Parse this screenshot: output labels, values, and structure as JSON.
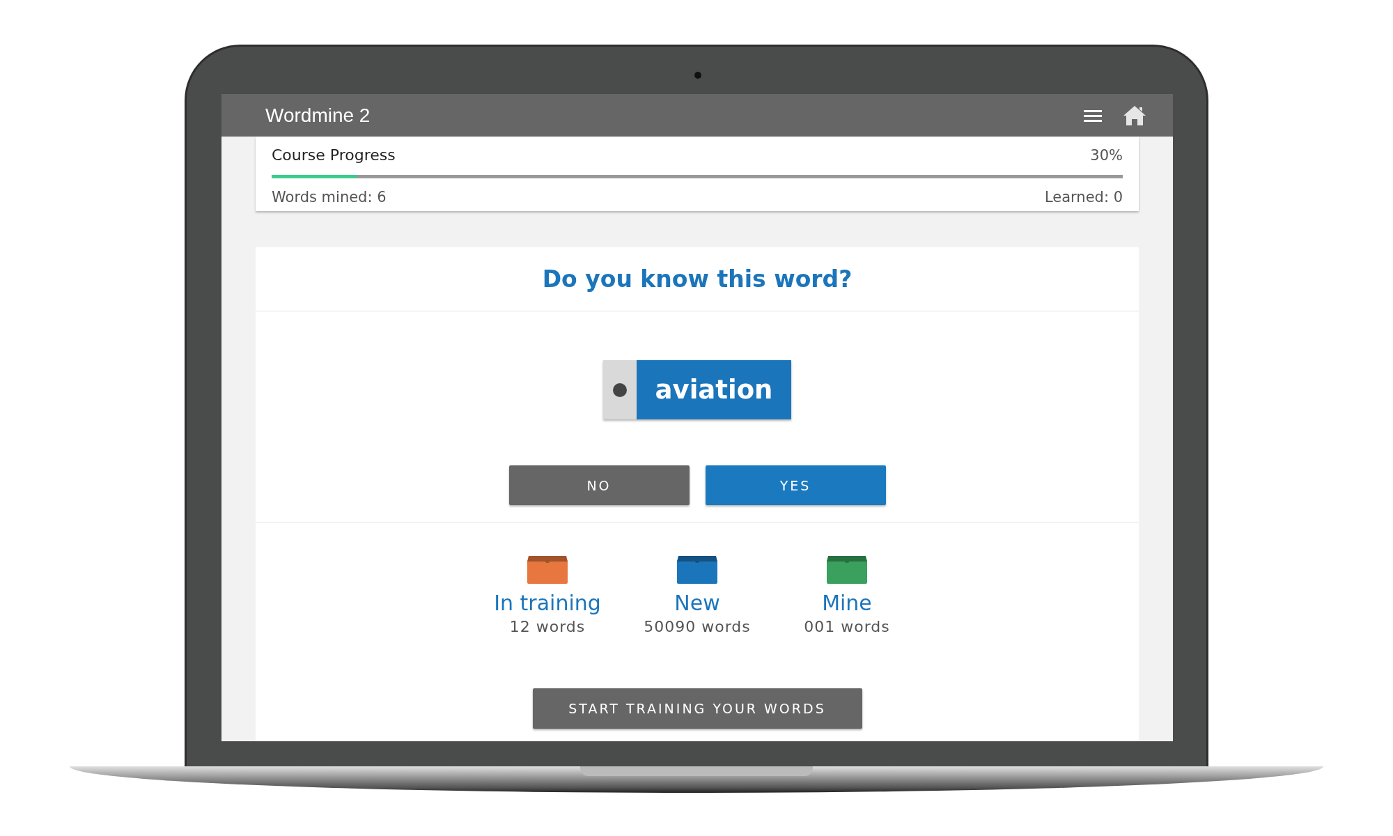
{
  "app": {
    "title": "Wordmine 2"
  },
  "progress": {
    "title": "Course Progress",
    "percent": "30%",
    "level": 0.1,
    "words_mined": "Words mined: 6",
    "learned": "Learned: 0"
  },
  "question": {
    "prompt": "Do you know this word?",
    "word": "aviation",
    "buttons": [
      {
        "label": "NO",
        "kind": "no"
      },
      {
        "label": "YES",
        "kind": "yes"
      }
    ]
  },
  "boxes": [
    {
      "label": "In training",
      "count": "12 words",
      "color": "#e8773f"
    },
    {
      "label": "New",
      "count": "50090 words",
      "color": "#1b75bb"
    },
    {
      "label": "Mine",
      "count": "001 words",
      "color": "#3aa05d"
    }
  ],
  "start_button": "START TRAINING YOUR WORDS"
}
